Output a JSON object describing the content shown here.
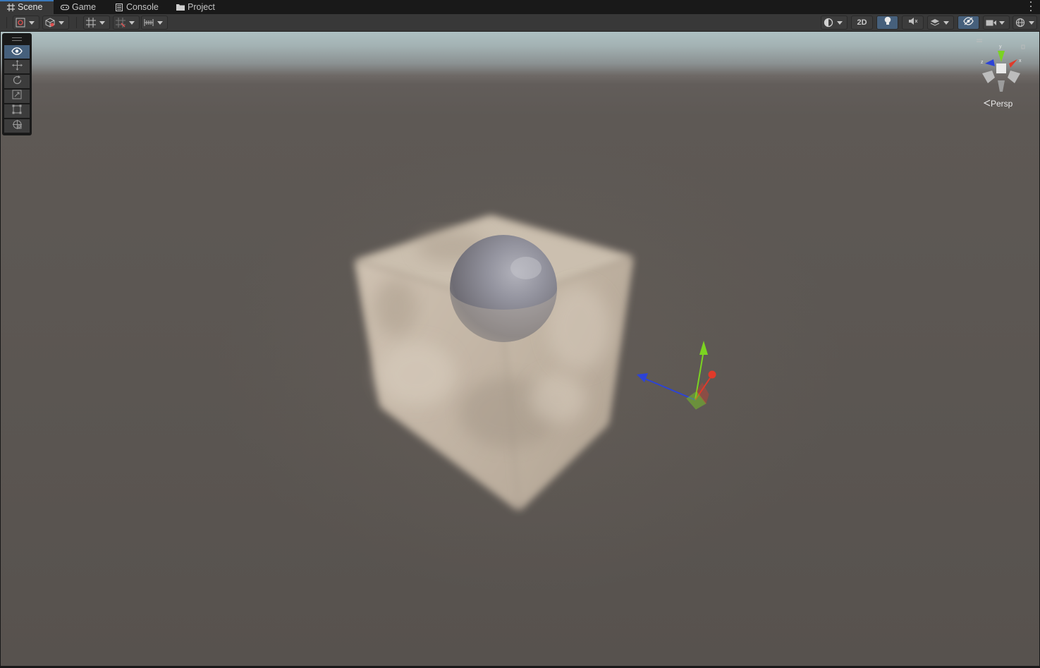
{
  "tabs": [
    {
      "label": "Scene",
      "icon": "hash-grid-icon",
      "active": true
    },
    {
      "label": "Game",
      "icon": "gamepad-icon",
      "active": false
    },
    {
      "label": "Console",
      "icon": "console-list-icon",
      "active": false
    },
    {
      "label": "Project",
      "icon": "folder-icon",
      "active": false
    }
  ],
  "toolbar": {
    "toggle_2d_label": "2D"
  },
  "viewport": {
    "projection_label": "Persp",
    "gizmo_axes": {
      "x": "x",
      "y": "y",
      "z": "z"
    }
  },
  "colors": {
    "accent": "#3a79bb",
    "selected_tool": "#46607c",
    "axis_x": "#e03a2a",
    "axis_y": "#7bd321",
    "axis_z": "#2c43d8"
  }
}
